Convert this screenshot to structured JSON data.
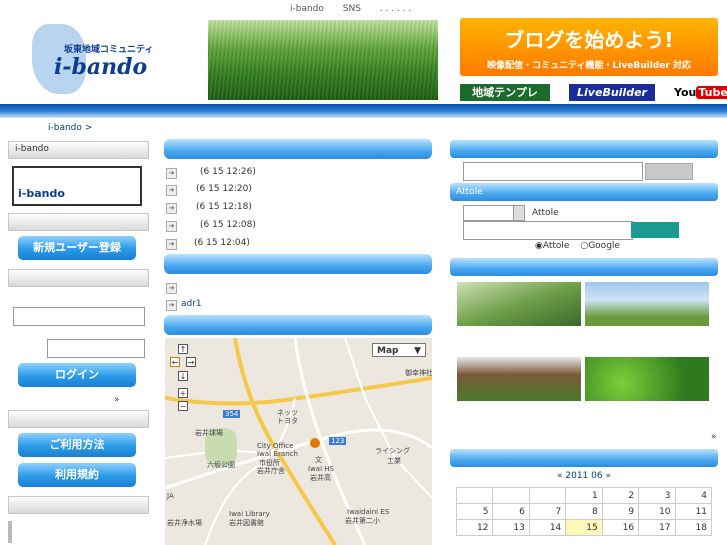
{
  "header": {
    "top_links": [
      "i-bando",
      "SNS",
      ".  .  .  .  .  ."
    ],
    "logo_sub": "坂東地域コミュニティ",
    "logo_name": "i-bando",
    "ad_headline": "ブログを始めよう!",
    "ad_sub": "映像配信・コミュニティ機能・LiveBuilder 対応",
    "btn_template": "地域テンプレ",
    "btn_livebuilder": "LiveBuilder",
    "btn_youtube_a": "You",
    "btn_youtube_b": "Tube"
  },
  "breadcrumb": "i-bando >",
  "left": {
    "head1": "i-bando",
    "box_title": "i-bando",
    "register_button": "新規ユーザー登録",
    "login_button": "ログイン",
    "more": "»",
    "usage_button": "ご利用方法",
    "terms_button": "利用規約"
  },
  "center": {
    "news": [
      {
        "time": "(6 15  12:26)"
      },
      {
        "time": "(6 15  12:20)"
      },
      {
        "time": "(6 15  12:18)"
      },
      {
        "time": "(6 15  12:08)"
      },
      {
        "time": "(6 15  12:04)"
      }
    ],
    "list2": [
      {
        "text": ""
      },
      {
        "text": "adr1"
      }
    ],
    "map": {
      "type_label": "Map",
      "labels": [
        "ネッツ",
        "トヨタ",
        "岩井球場",
        "City Office",
        "Iwai Branch",
        "市役所",
        "岩井庁舎",
        "文",
        "Iwai HS",
        "岩井高",
        "ライシング",
        "工業",
        "六坂公園",
        "Iwai Library",
        "岩井図書館",
        "Iwaidaini ES",
        "岩井第二小",
        "岩井浄水場",
        "JA",
        "123",
        "354",
        "御幸神社"
      ]
    }
  },
  "right": {
    "search_button": "",
    "attole_head": "Attole",
    "attole_label": "Attole",
    "radio_attole": "Attole",
    "radio_google": "Google",
    "photo_more": "»",
    "calendar_nav": "« 2011 06 »",
    "calendar_rows": [
      [
        "",
        "",
        "",
        "",
        "1",
        "2",
        "3",
        "4"
      ],
      [
        "",
        "5",
        "6",
        "7",
        "8",
        "9",
        "10",
        "11"
      ],
      [
        "",
        "12",
        "13",
        "14",
        "15",
        "16",
        "17",
        "18"
      ]
    ],
    "calendar_today": "15"
  },
  "colors": {
    "accent_blue": "#2b8ce0",
    "dark_blue": "#0b3d91",
    "ad_orange": "#ff8c00",
    "teal_button": "#1a9a90"
  }
}
